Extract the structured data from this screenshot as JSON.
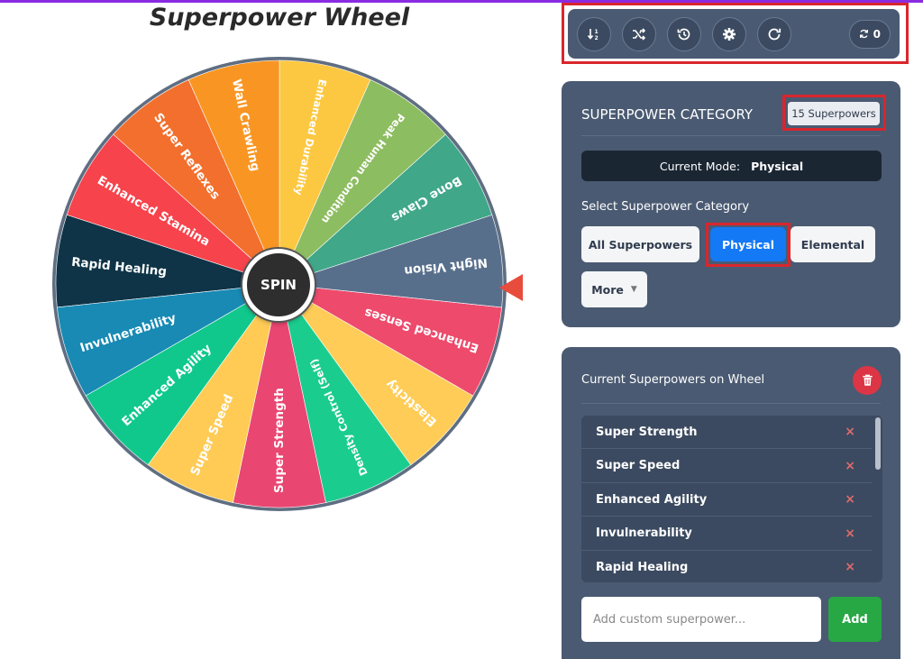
{
  "page": {
    "title": "Superpower Wheel"
  },
  "wheel": {
    "spin_label": "SPIN",
    "segments": [
      {
        "label": "Super Strength",
        "color": "#e94672"
      },
      {
        "label": "Density Control (Self)",
        "color": "#1bcc8f"
      },
      {
        "label": "Elasticity",
        "color": "#ffcd57"
      },
      {
        "label": "Enhanced Senses",
        "color": "#ed4a6c"
      },
      {
        "label": "Night Vision",
        "color": "#586f8c"
      },
      {
        "label": "Bone Claws",
        "color": "#40a789"
      },
      {
        "label": "Peak Human Condition",
        "color": "#8dbd61"
      },
      {
        "label": "Enhanced Durability",
        "color": "#fdc841"
      },
      {
        "label": "Wall Crawling",
        "color": "#f99623"
      },
      {
        "label": "Super Reflexes",
        "color": "#f36f2d"
      },
      {
        "label": "Enhanced Stamina",
        "color": "#f6434c"
      },
      {
        "label": "Rapid Healing",
        "color": "#0f3447"
      },
      {
        "label": "Invulnerability",
        "color": "#188ab4"
      },
      {
        "label": "Enhanced Agility",
        "color": "#10c88c"
      },
      {
        "label": "Super Speed",
        "color": "#ffcb55"
      }
    ]
  },
  "toolbar": {
    "buttons": [
      "sort-icon",
      "shuffle-icon",
      "history-icon",
      "gear-icon",
      "redo-icon"
    ],
    "counter_value": "0"
  },
  "category": {
    "title": "SUPERPOWER CATEGORY",
    "count_badge": "15 Superpowers",
    "mode_label": "Current Mode:",
    "mode_value": "Physical",
    "select_label": "Select Superpower Category",
    "buttons": {
      "all": "All Superpowers",
      "physical": "Physical",
      "elemental": "Elemental",
      "more": "More"
    }
  },
  "list": {
    "title": "Current Superpowers on Wheel",
    "items": [
      "Super Strength",
      "Super Speed",
      "Enhanced Agility",
      "Invulnerability",
      "Rapid Healing"
    ],
    "remove_symbol": "×",
    "input_placeholder": "Add custom superpower...",
    "add_label": "Add"
  },
  "colors": {
    "panel": "#4a5a72",
    "highlight": "#d9262c",
    "accent_blue": "#1479f5",
    "add_green": "#28a745",
    "trash_red": "#dc3545"
  }
}
